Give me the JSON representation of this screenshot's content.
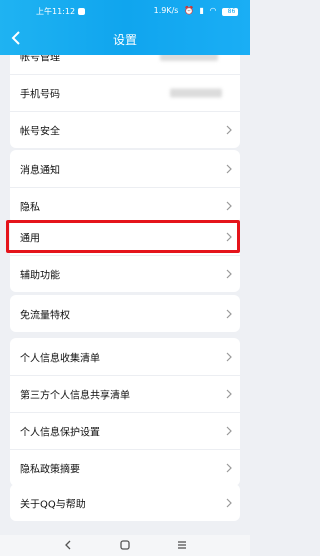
{
  "status": {
    "time": "上午11:12",
    "net": "1.9K/s",
    "battery": "86"
  },
  "header": {
    "title": "设置"
  },
  "account": [
    "帐号管理",
    "手机号码",
    "帐号安全"
  ],
  "notify": [
    "消息通知",
    "隐私"
  ],
  "general": [
    "通用",
    "辅助功能"
  ],
  "traffic": [
    "免流量特权"
  ],
  "info": [
    "个人信息收集清单",
    "第三方个人信息共享清单",
    "个人信息保护设置",
    "隐私政策摘要"
  ],
  "about": [
    "关于QQ与帮助"
  ],
  "colors": {
    "accent": "#10a5ee",
    "highlight": "#e5141b"
  }
}
